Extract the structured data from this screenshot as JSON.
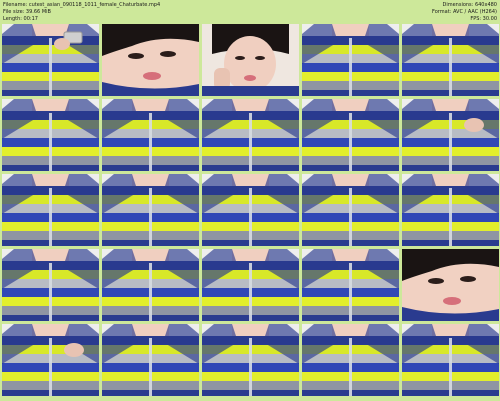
{
  "header": {
    "filename": "Filename: cutest_asian_090118_1011_female_Chaturbate.mp4",
    "filesize": "File size: 39.66 MiB",
    "length": "Length: 00:17",
    "dimensions": "Dimensions: 640x480",
    "format": "Format: AVC / AAC (H264)",
    "fps": "FPS: 30.00"
  },
  "thumbnails": [
    {
      "type": "torso-phone"
    },
    {
      "type": "face-close"
    },
    {
      "type": "face-hand"
    },
    {
      "type": "torso"
    },
    {
      "type": "torso"
    },
    {
      "type": "torso"
    },
    {
      "type": "torso"
    },
    {
      "type": "torso"
    },
    {
      "type": "torso"
    },
    {
      "type": "torso-hand"
    },
    {
      "type": "torso"
    },
    {
      "type": "torso"
    },
    {
      "type": "torso"
    },
    {
      "type": "torso"
    },
    {
      "type": "torso"
    },
    {
      "type": "torso"
    },
    {
      "type": "torso"
    },
    {
      "type": "torso"
    },
    {
      "type": "torso"
    },
    {
      "type": "face-close"
    },
    {
      "type": "torso-hand"
    },
    {
      "type": "torso"
    },
    {
      "type": "torso"
    },
    {
      "type": "torso"
    },
    {
      "type": "torso"
    }
  ]
}
